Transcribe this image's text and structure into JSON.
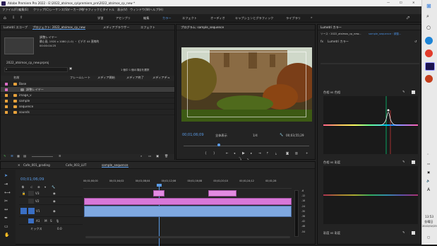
{
  "window": {
    "title": "Adobe Premiere Pro 2022 - E:\\2022_atsimos_cp\\premiere_pro\\2022_atsimos_cp_new *"
  },
  "menu": [
    "ファイル(F)",
    "編集(E)",
    "クリップ(C)",
    "シーケンス(S)",
    "マーカー(M)",
    "グラフィックとタイトル",
    "表示(V)",
    "ウィンドウ(W)",
    "ヘルプ(H)"
  ],
  "workspaces": [
    "学習",
    "アセンブリ",
    "編集",
    "カラー",
    "エフェクト",
    "オーディオ",
    "キャプションとグラフィック",
    "ライブラリ"
  ],
  "active_workspace": "カラー",
  "project": {
    "tabs": [
      "Lumetri スコープ",
      "プロジェクト: 2022_atsimos_cp_new",
      "メディアブラウザー",
      "エフェクト"
    ],
    "clip_name": "調整レイヤー",
    "clip_info1": "静止画, 1920 x 1080 (1.0) ・ ビデオ 44 直線的",
    "clip_info2": "00:00:04:25",
    "file_name": "2022_atsimos_cp_new.prproj",
    "selection": "1 個中 1 個の項目を選択",
    "columns": [
      "名前",
      "フレームレート",
      "メディア開始",
      "メディア終了",
      "メディアデュ"
    ],
    "items": [
      {
        "name": "Base",
        "indent": 0,
        "color": "#d96cc4"
      },
      {
        "name": "調整レイヤー",
        "indent": 1,
        "color": "#d96cc4"
      },
      {
        "name": "image_v",
        "indent": 0,
        "color": "#e8a23b"
      },
      {
        "name": "sample",
        "indent": 0,
        "color": "#e8a23b"
      },
      {
        "name": "sequence",
        "indent": 0,
        "color": "#e8a23b"
      },
      {
        "name": "sounds",
        "indent": 0,
        "color": "#e8a23b"
      }
    ]
  },
  "program": {
    "tab": "プログラム: sample_sequence",
    "timecode": "00;01;06;09",
    "fit": "全体表示",
    "scale": "1/4",
    "duration": "00;03;55;29"
  },
  "lumetri": {
    "tab": "Lumetri カラー",
    "source": "ソース・2022_atsimos_cp_new...",
    "sequence": "sample_sequence・調整...",
    "fx_label": "Lumetri カラー",
    "curves": [
      "色相 vs 色相",
      "色相 vs 彩度",
      "彩度 vs 彩度"
    ]
  },
  "timeline": {
    "tabs": [
      "Cafe_001_grading",
      "Cafe_003_LUT",
      "sample_sequence"
    ],
    "active_tab": "sample_sequence",
    "timecode": "00;01;06;09",
    "ruler": [
      "00;01;00;00",
      "00;01;04;02",
      "00;01;08;04",
      "00;01;12;06",
      "00;01;16;08",
      "00;01;20;10",
      "00;01;24;12",
      "00;01;28"
    ],
    "tracks": [
      "V3",
      "V2",
      "V1",
      "A1"
    ],
    "master_label": "ミックス",
    "master_value": "0.0",
    "meter_ticks": [
      "-6",
      "-12",
      "-18",
      "-24",
      "-30",
      "-36",
      "-42",
      "-48",
      "-54"
    ]
  },
  "taskbar": {
    "time": "13:53",
    "day": "金曜日",
    "date": "2022/02/25"
  }
}
